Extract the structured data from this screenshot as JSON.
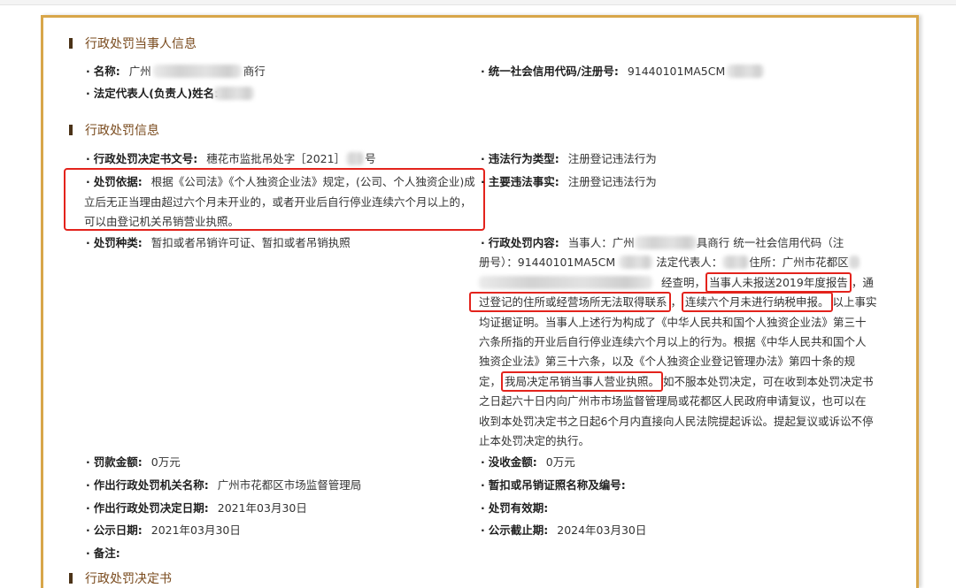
{
  "sections": {
    "party_title": "行政处罚当事人信息",
    "penalty_title": "行政处罚信息",
    "decision_title": "行政处罚决定书"
  },
  "party": {
    "name": {
      "label": "名称:",
      "prefix": "广州",
      "suffix": "商行"
    },
    "credit_code": {
      "label": "统一社会信用代码/注册号:",
      "value": "91440101MA5CM"
    },
    "legal_rep": {
      "label": "法定代表人(负责人)姓名:"
    }
  },
  "penalty": {
    "doc_no": {
      "label": "行政处罚决定书文号:",
      "prefix": "穗花市监批吊处字［2021］",
      "suffix": "号"
    },
    "violation_type": {
      "label": "违法行为类型:",
      "value": "注册登记违法行为"
    },
    "basis": {
      "label": "处罚依据:",
      "lines": [
        "根据《公司法》《个人独资企业法》规定，(公司、个人独资企业)成",
        "立后无正当理由超过六个月未开业的，或者开业后自行停业连续六个月以上的，",
        "可以由登记机关吊销营业执照。"
      ]
    },
    "main_facts": {
      "label": "主要违法事实:",
      "value": "注册登记违法行为"
    },
    "category": {
      "label": "处罚种类:",
      "value": "暂扣或者吊销许可证、暂扣或者吊销执照"
    },
    "content": {
      "label": "行政处罚内容:",
      "lines": [
        [
          "当事人：广州",
          "具商行 统一社会信用代码（注"
        ],
        [
          "册号）：91440101MA5CM",
          "法定代表人：",
          "住所：广州市花都区"
        ],
        [
          "经查明，",
          "当事人未报送2019年度报告",
          "，通"
        ],
        [
          "过登记的住所或经营场所无法取得联系",
          "，",
          "连续六个月未进行纳税申报。",
          "以上事实"
        ],
        [
          "均证据证明。当事人上述行为构成了《中华人民共和国个人独资企业法》第三十"
        ],
        [
          "六条所指的开业后自行停业连续六个月以上的行为。根据《中华人民共和国个人"
        ],
        [
          "独资企业法》第三十六条，以及《个人独资企业登记管理办法》第四十条的规"
        ],
        [
          "定，",
          "我局决定吊销当事人营业执照。",
          "如不服本处罚决定，可在收到本处罚决定书"
        ],
        [
          "之日起六十日内向广州市市场监督管理局或花都区人民政府申请复议，也可以在"
        ],
        [
          "收到本处罚决定书之日起6个月内直接向人民法院提起诉讼。提起复议或诉讼不停"
        ],
        [
          "止本处罚决定的执行。"
        ]
      ]
    },
    "fine": {
      "label": "罚款金额:",
      "value": "0万元"
    },
    "confiscation": {
      "label": "没收金额:",
      "value": "0万元"
    },
    "authority": {
      "label": "作出行政处罚机关名称:",
      "value": "广州市花都区市场监督管理局"
    },
    "license": {
      "label": "暂扣或吊销证照名称及编号:"
    },
    "decision_date": {
      "label": "作出行政处罚决定日期:",
      "value": "2021年03月30日"
    },
    "validity": {
      "label": "处罚有效期:"
    },
    "publish_date": {
      "label": "公示日期:",
      "value": "2021年03月30日"
    },
    "publish_end": {
      "label": "公示截止期:",
      "value": "2024年03月30日"
    },
    "remark": {
      "label": "备注:"
    }
  },
  "colors": {
    "card_border": "#d8a64a",
    "section_title": "#7a4b1e",
    "section_marker": "#4b3318",
    "annotation_red": "#e3231c"
  }
}
